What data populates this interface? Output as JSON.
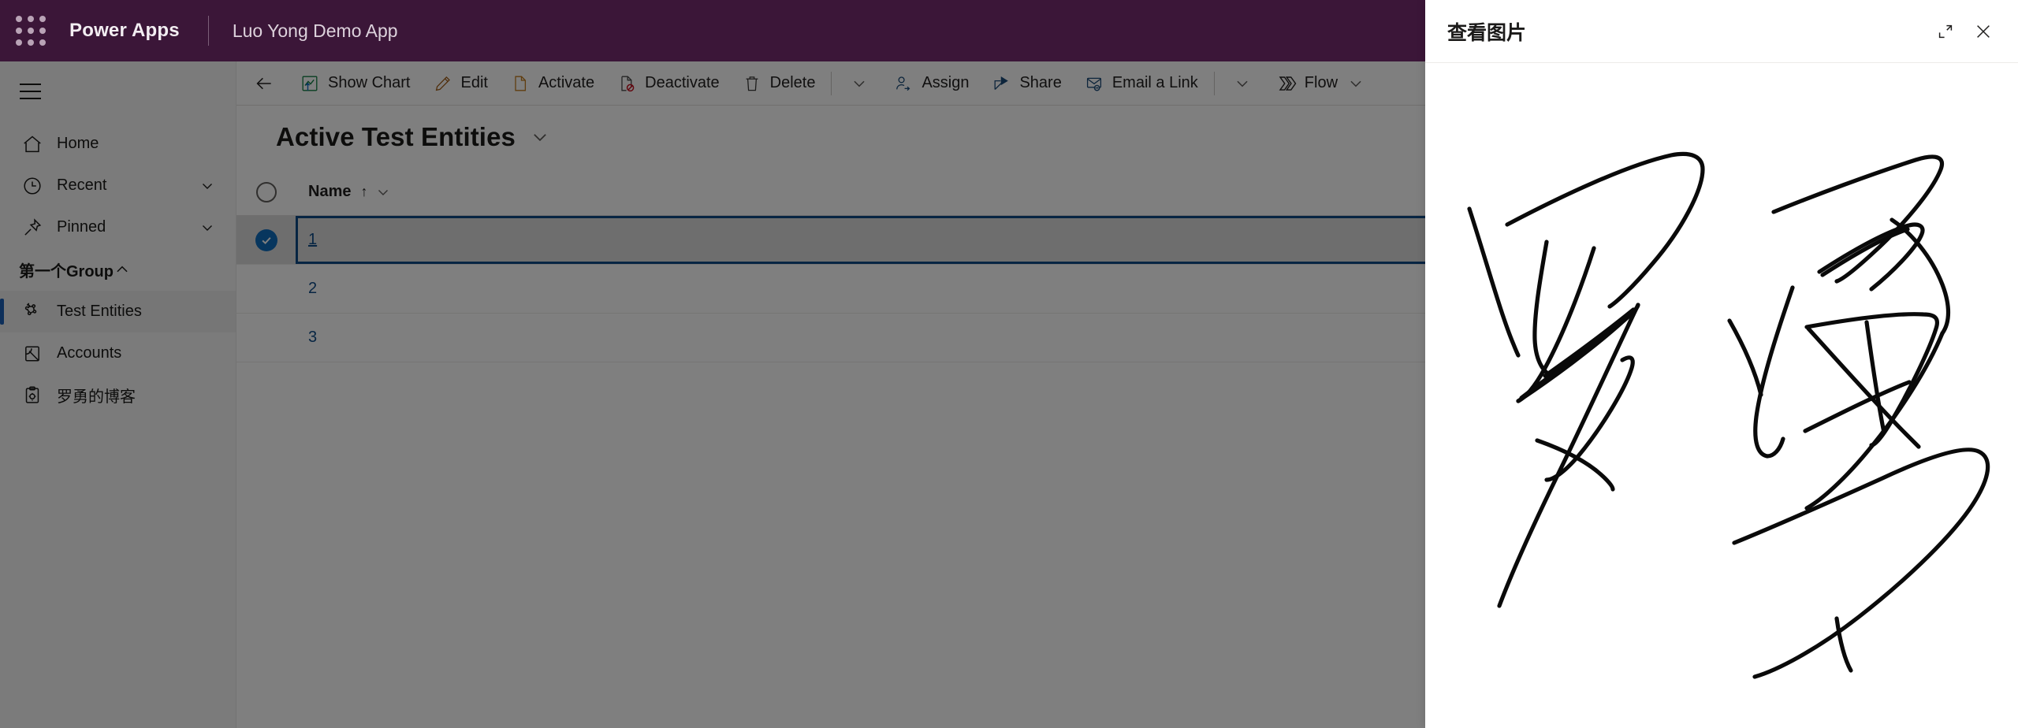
{
  "suite_header": {
    "waffle_icon": "app-launcher-icon",
    "brand": "Power Apps",
    "app_name": "Luo Yong Demo App",
    "bar_color": "#3B1638"
  },
  "sitemap": {
    "hamburger_icon": "hamburger-menu-icon",
    "items": [
      {
        "label": "Home",
        "icon": "home-icon",
        "chevron": false,
        "selected": false
      },
      {
        "label": "Recent",
        "icon": "clock-icon",
        "chevron": true,
        "selected": false
      },
      {
        "label": "Pinned",
        "icon": "pin-icon",
        "chevron": true,
        "selected": false
      }
    ],
    "group": {
      "label": "第一个Group",
      "expanded": true,
      "chevron_icon": "chevron-up-icon",
      "items": [
        {
          "label": "Test Entities",
          "icon": "entity-icon",
          "selected": true
        },
        {
          "label": "Accounts",
          "icon": "accounts-icon",
          "selected": false
        },
        {
          "label": "罗勇的博客",
          "icon": "clipboard-gear-icon",
          "selected": false
        }
      ]
    },
    "selected_accent": "#1a5fb4"
  },
  "command_bar": {
    "back_icon": "back-arrow-icon",
    "items": [
      {
        "label": "Show Chart",
        "icon": "chart-icon",
        "type": "button"
      },
      {
        "label": "Edit",
        "icon": "pencil-icon",
        "type": "button"
      },
      {
        "label": "Activate",
        "icon": "activate-icon",
        "type": "button"
      },
      {
        "label": "Deactivate",
        "icon": "deactivate-icon",
        "type": "button"
      },
      {
        "label": "Delete",
        "icon": "trash-icon",
        "type": "button"
      },
      {
        "label": "",
        "icon": "chevron-down-icon",
        "type": "overflow"
      },
      {
        "label": "Assign",
        "icon": "assign-user-icon",
        "type": "button"
      },
      {
        "label": "Share",
        "icon": "share-icon",
        "type": "button"
      },
      {
        "label": "Email a Link",
        "icon": "email-link-icon",
        "type": "button"
      },
      {
        "label": "",
        "icon": "chevron-down-icon",
        "type": "overflow"
      },
      {
        "label": "Flow",
        "icon": "flow-icon",
        "type": "menu"
      }
    ]
  },
  "view": {
    "title": "Active Test Entities",
    "title_chevron_icon": "chevron-down-icon"
  },
  "grid": {
    "select_all_icon": "select-all-circle-icon",
    "columns": [
      {
        "label": "Name",
        "sort": "↑",
        "chevron_icon": "chevron-down-icon"
      }
    ],
    "rows": [
      {
        "name": "1",
        "selected": true
      },
      {
        "name": "2",
        "selected": false
      },
      {
        "name": "3",
        "selected": false
      }
    ],
    "selected_row_bg": "#dcdcdc",
    "link_color": "#0f4b86",
    "checked_badge_color": "#0f6cbd"
  },
  "side_pane": {
    "title": "查看图片",
    "expand_icon": "popout-expand-icon",
    "close_icon": "close-icon",
    "image_alt": "signature-image"
  },
  "overlay": {
    "color": "#000000",
    "opacity": "0.5"
  }
}
